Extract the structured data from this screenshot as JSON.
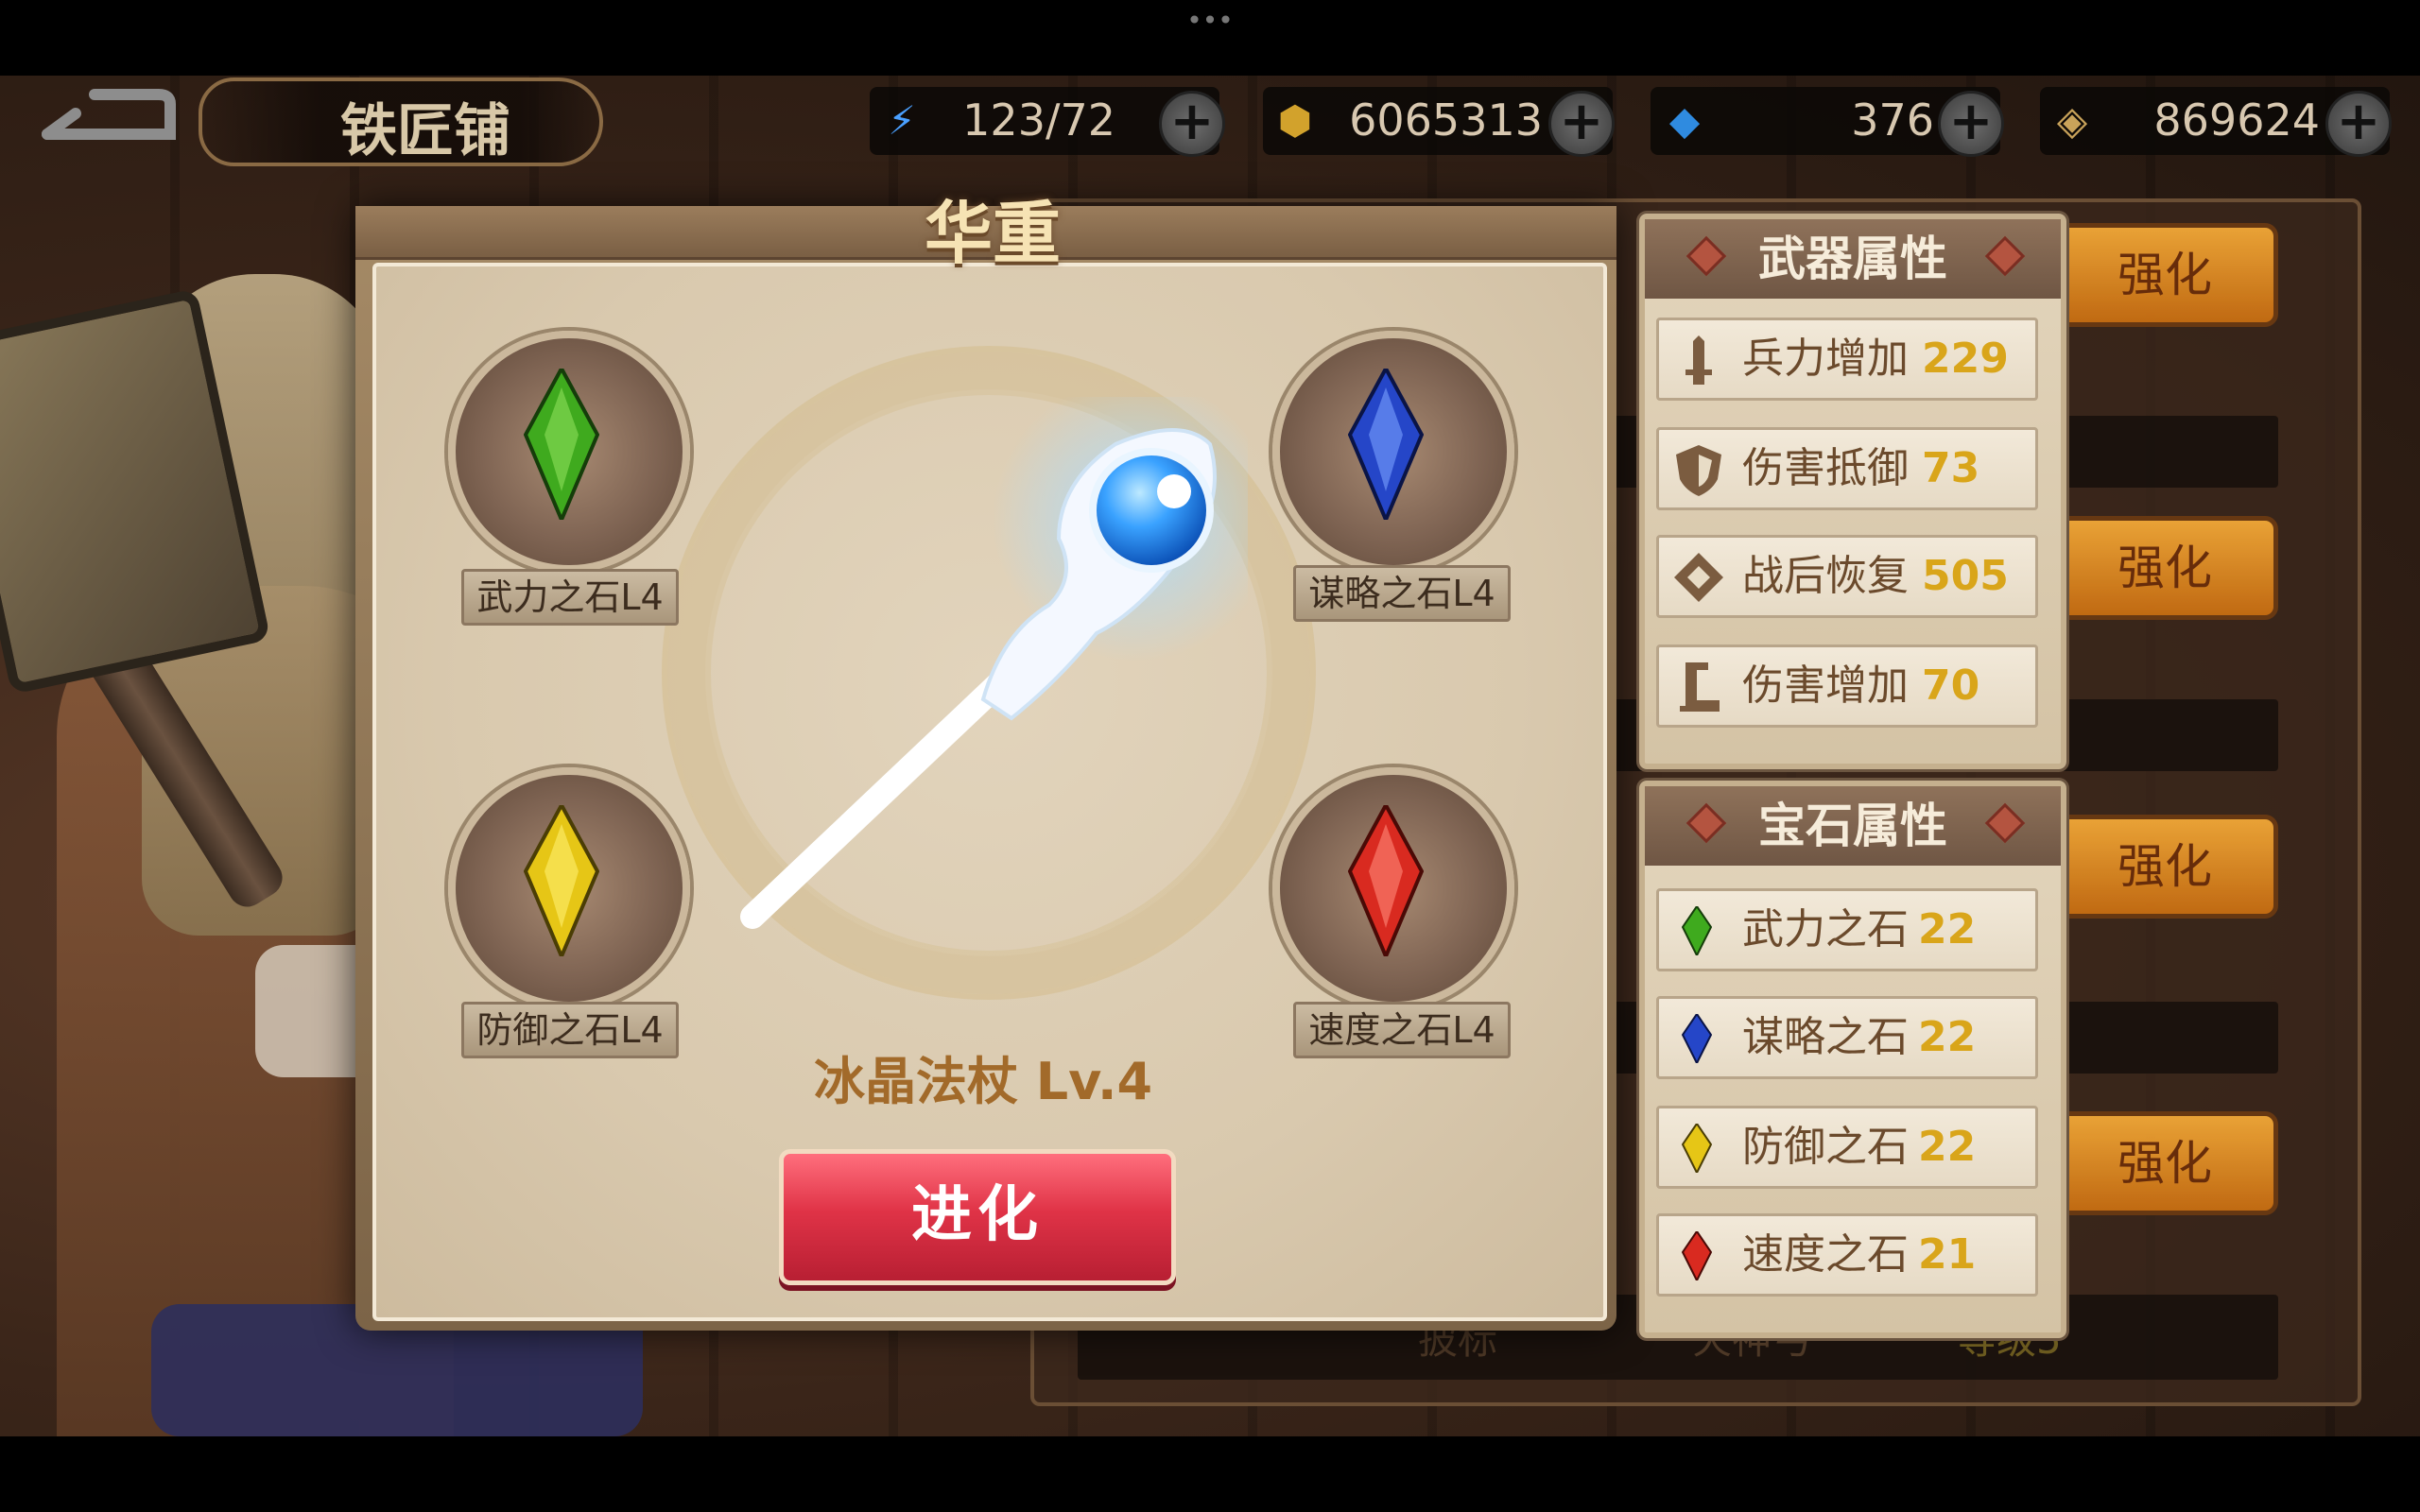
{
  "header": {
    "title": "铁匠铺",
    "resources": [
      {
        "icon": "energy-icon",
        "value": "123/72"
      },
      {
        "icon": "gold-coin-icon",
        "value": "6065313"
      },
      {
        "icon": "blue-crystal-icon",
        "value": "376"
      },
      {
        "icon": "scroll-coin-icon",
        "value": "869624"
      }
    ]
  },
  "panel": {
    "title": "华重",
    "weapon_name": "冰晶法杖 Lv.4",
    "evolve_label": "进化",
    "stones": [
      {
        "label": "武力之石L4",
        "color": "#3faa1e"
      },
      {
        "label": "谋略之石L4",
        "color": "#2546c8"
      },
      {
        "label": "防御之石L4",
        "color": "#e6c616"
      },
      {
        "label": "速度之石L4",
        "color": "#d92a20"
      }
    ]
  },
  "weapon_attrs": {
    "title": "武器属性",
    "rows": [
      {
        "label": "兵力增加",
        "value": "229"
      },
      {
        "label": "伤害抵御",
        "value": "73"
      },
      {
        "label": "战后恢复",
        "value": "505"
      },
      {
        "label": "伤害增加",
        "value": "70"
      }
    ]
  },
  "gem_attrs": {
    "title": "宝石属性",
    "rows": [
      {
        "label": "武力之石",
        "value": "22",
        "color": "#3faa1e"
      },
      {
        "label": "谋略之石",
        "value": "22",
        "color": "#2546c8"
      },
      {
        "label": "防御之石",
        "value": "22",
        "color": "#e6c616"
      },
      {
        "label": "速度之石",
        "value": "21",
        "color": "#d92a20"
      }
    ]
  },
  "background": {
    "strengthen_label": "强化",
    "bottom_row": [
      "披标",
      "火神弓",
      "等级5"
    ]
  }
}
